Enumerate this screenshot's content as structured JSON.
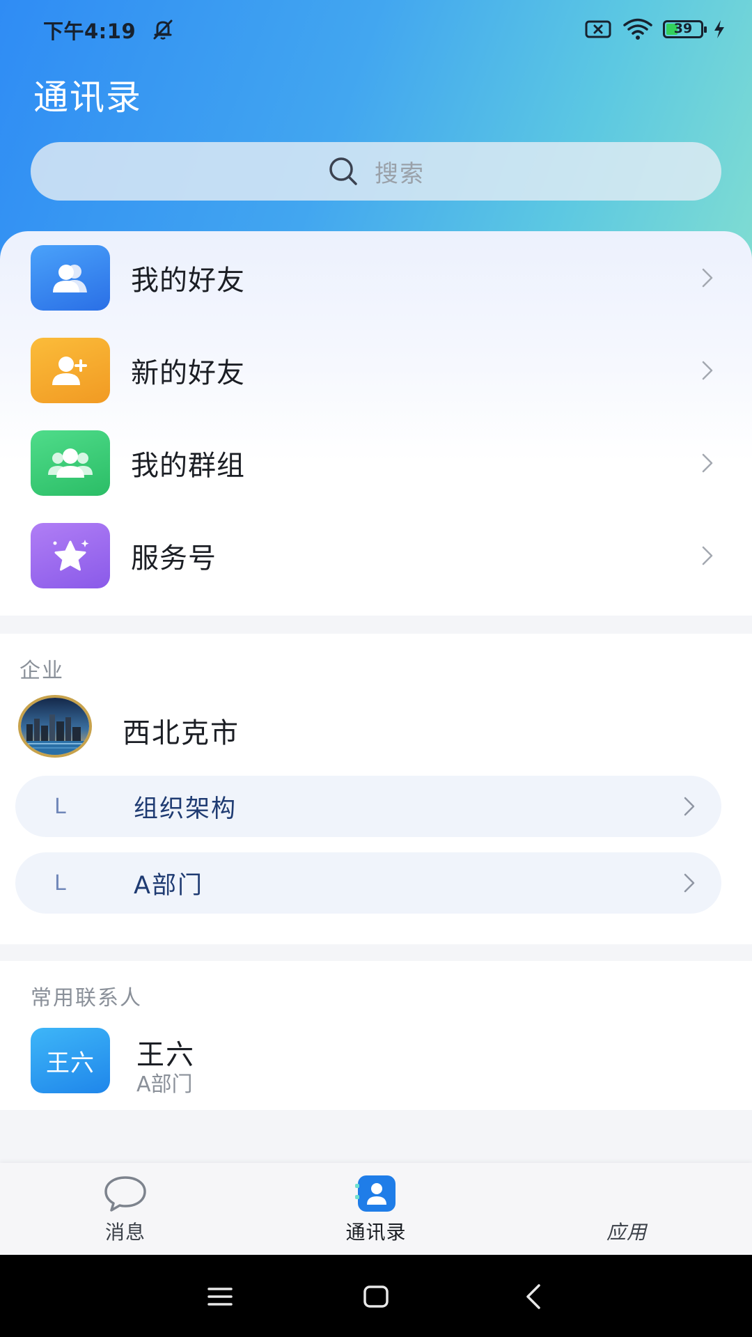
{
  "status_bar": {
    "time": "下午4:19",
    "battery": "39",
    "battery_level": 0.39,
    "icons": [
      "bell-off-icon",
      "sim-disabled-icon",
      "wifi-icon",
      "battery-icon",
      "charging-icon"
    ]
  },
  "header": {
    "title": "通讯录",
    "search_placeholder": "搜索"
  },
  "menu": [
    {
      "label": "我的好友",
      "icon": "friends-icon",
      "color": "#3f86f2"
    },
    {
      "label": "新的好友",
      "icon": "add-friend-icon",
      "color": "#f5a52c"
    },
    {
      "label": "我的群组",
      "icon": "group-icon",
      "color": "#3ecf7a"
    },
    {
      "label": "服务号",
      "icon": "star-icon",
      "color": "#9a6ef0"
    }
  ],
  "enterprise": {
    "section_label": "企业",
    "name": "西北克市",
    "items": [
      {
        "prefix": "L",
        "label": "组织架构"
      },
      {
        "prefix": "L",
        "label": "A部门"
      }
    ]
  },
  "frequent_contacts": {
    "section_label": "常用联系人",
    "contacts": [
      {
        "avatar_text": "王六",
        "name": "王六",
        "dept": "A部门"
      }
    ]
  },
  "tabbar": {
    "tabs": [
      {
        "label": "消息",
        "icon": "chat-bubble-icon",
        "active": false
      },
      {
        "label": "通讯录",
        "icon": "contacts-icon",
        "active": true
      },
      {
        "label": "应用",
        "icon": "apps-icon",
        "active": false
      }
    ],
    "active_color": "#1f7de8"
  },
  "system_nav": {
    "buttons": [
      "menu-icon",
      "home-icon",
      "back-icon"
    ]
  }
}
